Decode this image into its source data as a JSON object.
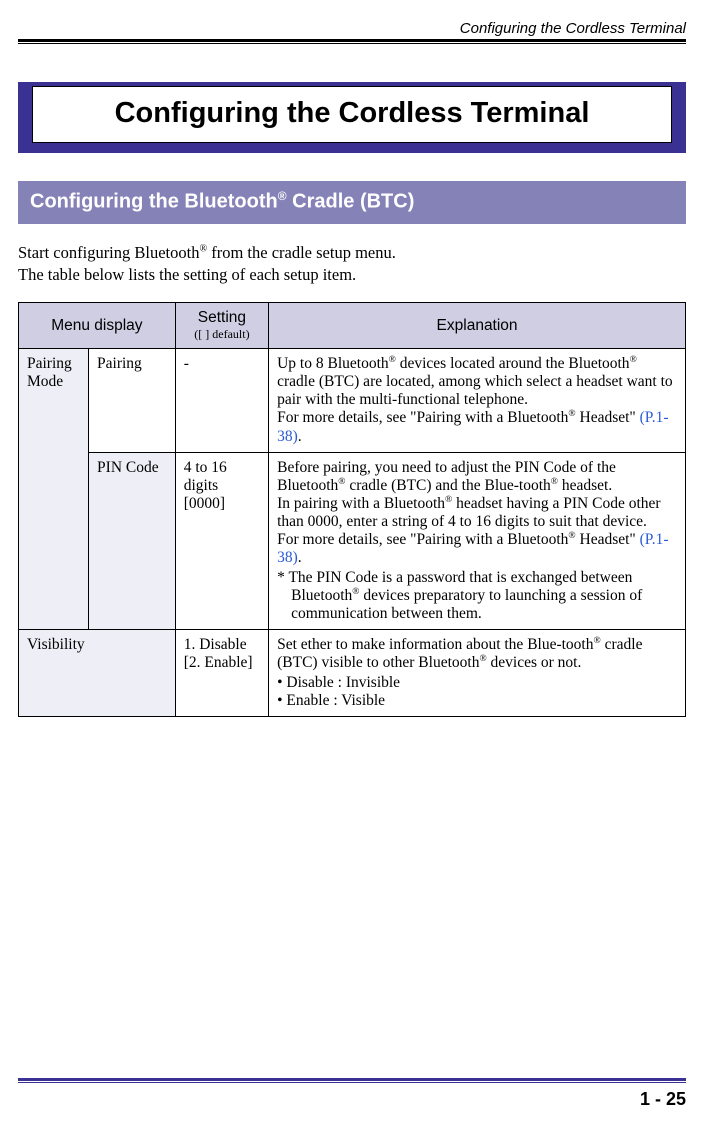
{
  "running_head": "Configuring the Cordless Terminal",
  "banner_title": "Configuring the Cordless Terminal",
  "section_title_pre": "Configuring the Bluetooth",
  "section_title_sup": "®",
  "section_title_post": " Cradle (BTC)",
  "intro_line1_pre": "Start configuring Bluetooth",
  "intro_line1_sup": "®",
  "intro_line1_post": " from the cradle setup menu.",
  "intro_line2": "The table below lists the setting of each setup item.",
  "table": {
    "headers": {
      "menu": "Menu display",
      "setting": "Setting",
      "setting_sub": "([ ] default)",
      "explanation": "Explanation"
    },
    "rows": {
      "pairing_mode_label": "Pairing Mode",
      "pairing": {
        "sub": "Pairing",
        "setting": "-",
        "expl_a": "Up to 8 Bluetooth",
        "sup1": "®",
        "expl_b": " devices located around the Bluetooth",
        "sup2": "®",
        "expl_c": " cradle (BTC) are located, among which select a headset want to pair with the multi-functional telephone.",
        "expl_d": "For more details, see \"Pairing with a Bluetooth",
        "sup3": "®",
        "expl_e": " Headset\"  ",
        "link": "(P.1-38)",
        "expl_f": "."
      },
      "pincode": {
        "sub": "PIN Code",
        "setting_l1": "4 to 16 digits",
        "setting_l2": "[0000]",
        "expl_a": "Before pairing, you need to adjust the PIN Code of the Bluetooth",
        "sup1": "®",
        "expl_b": " cradle (BTC) and the Blue-tooth",
        "sup2": "®",
        "expl_c": " headset.",
        "expl_d": "In pairing with a Bluetooth",
        "sup3": "®",
        "expl_e": " headset having a PIN Code other than 0000, enter a string of 4 to 16 digits to suit that device.",
        "expl_f": "For more details, see \"Pairing with a Bluetooth",
        "sup4": "®",
        "expl_g": " Headset\"  ",
        "link": "(P.1-38)",
        "expl_h": ".",
        "note_a": "* The PIN Code is a password that is exchanged between Bluetooth",
        "sup5": "®",
        "note_b": " devices preparatory to launching a session of communication between them."
      },
      "visibility": {
        "label": "Visibility",
        "setting_l1": "1. Disable",
        "setting_l2": "[2. Enable]",
        "expl_a": "Set ether to make information about the Blue-tooth",
        "sup1": "®",
        "expl_b": " cradle (BTC) visible to other Bluetooth",
        "sup2": "®",
        "expl_c": " devices or not.",
        "bullet1": "• Disable : Invisible",
        "bullet2": "• Enable  : Visible"
      }
    }
  },
  "page_number": "1 - 25"
}
